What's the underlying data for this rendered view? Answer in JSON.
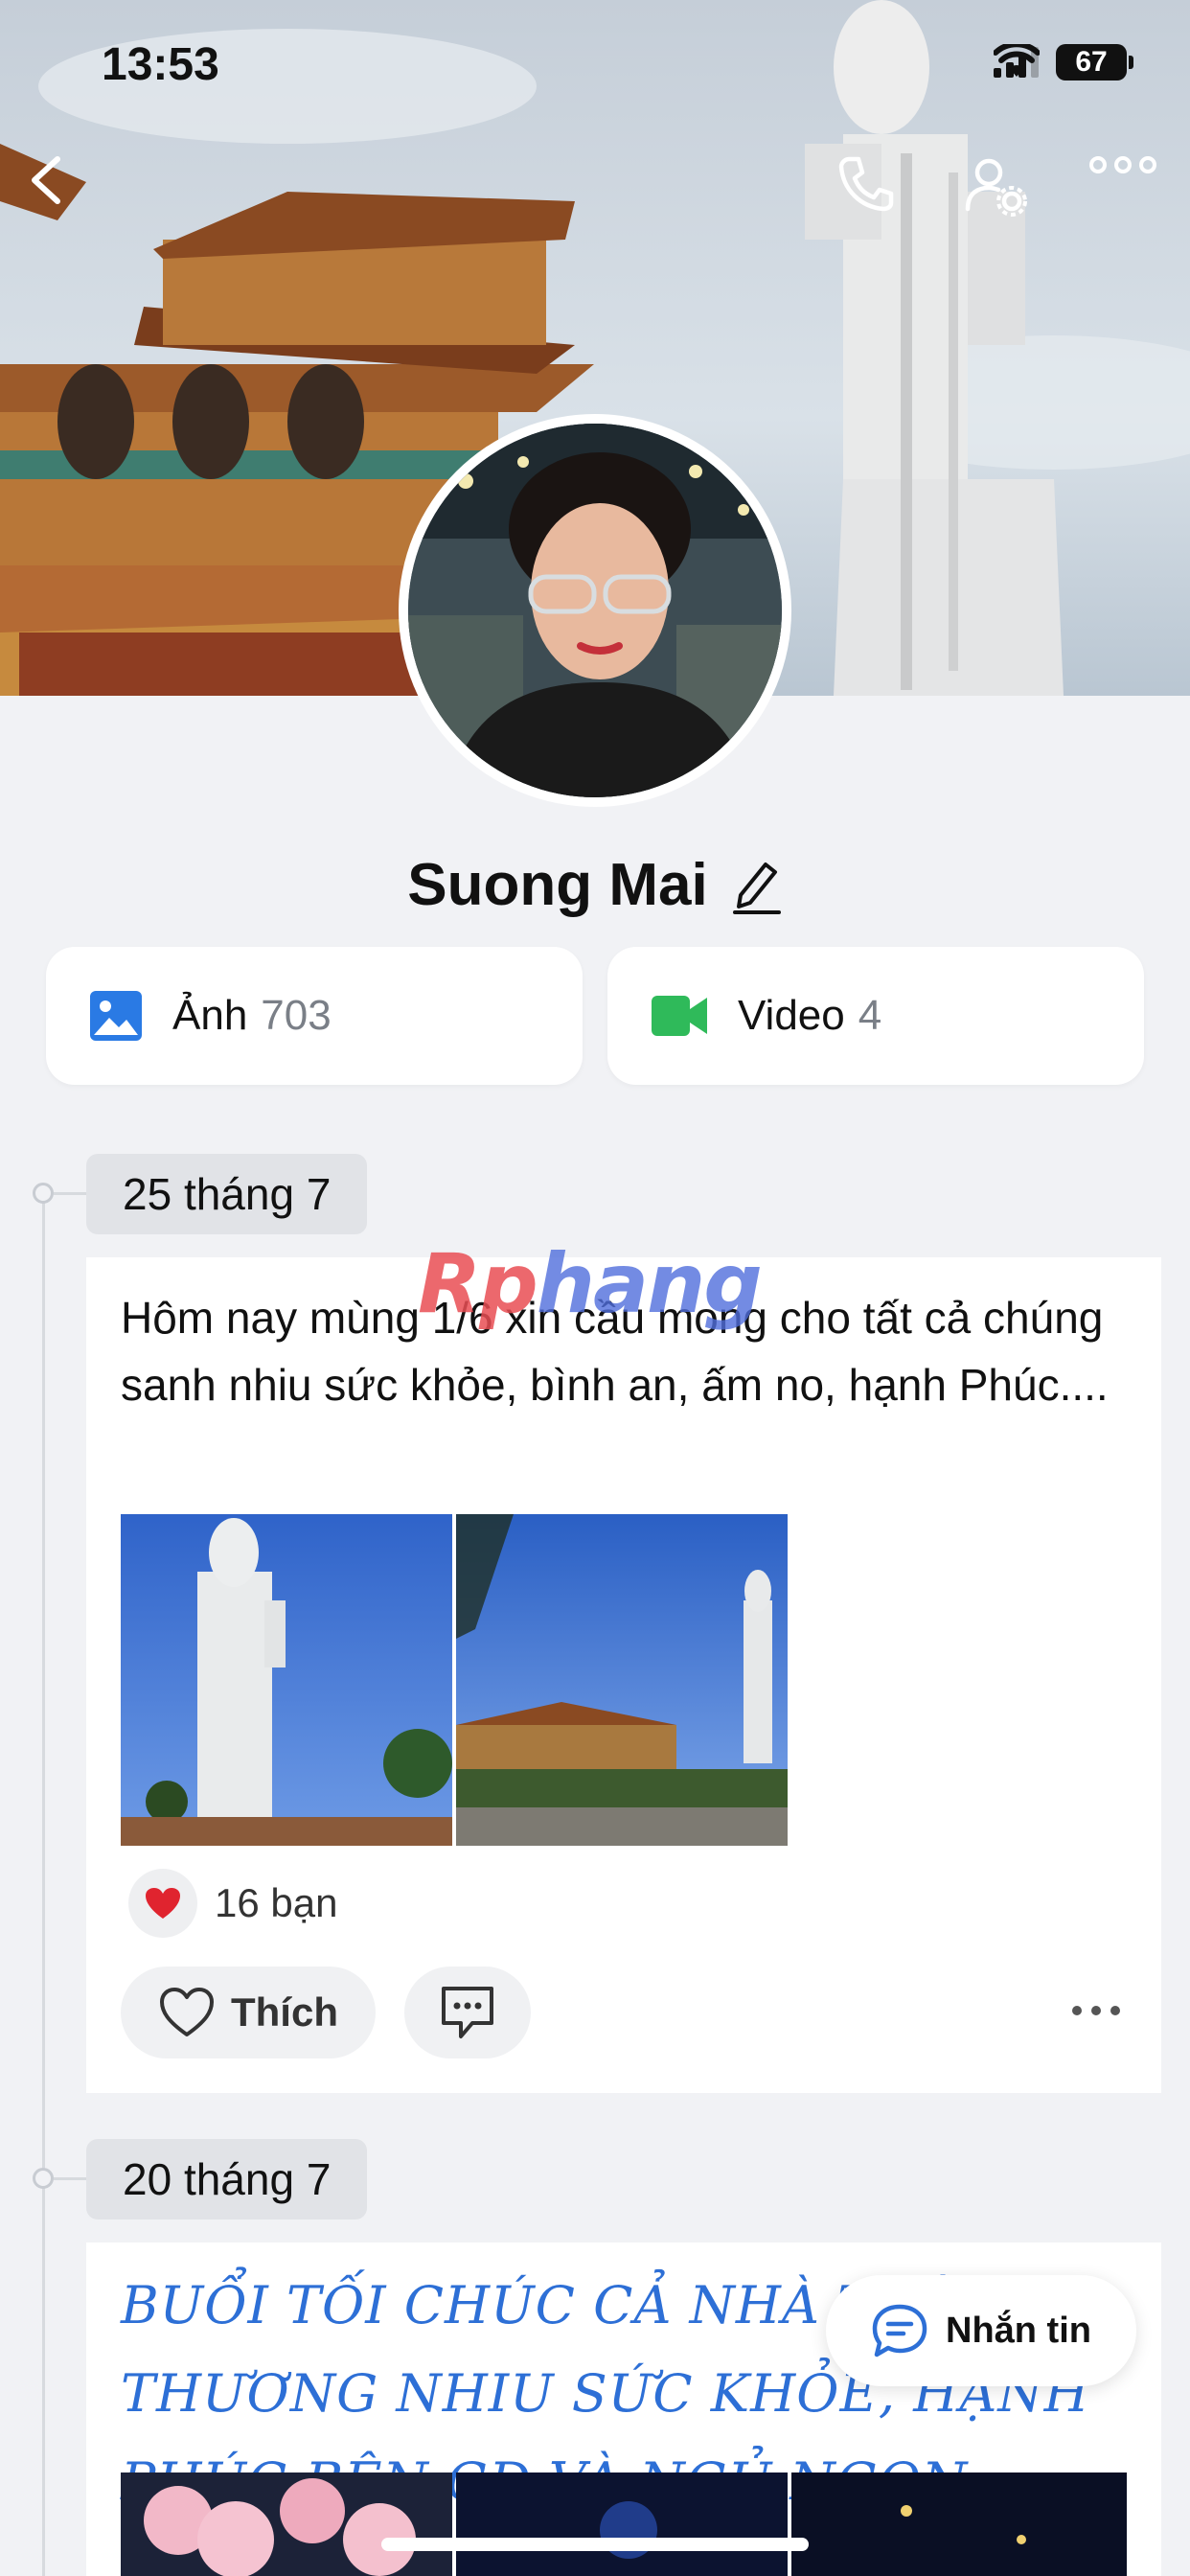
{
  "status_bar": {
    "time": "13:53",
    "battery": "67"
  },
  "profile": {
    "name": "Suong Mai"
  },
  "media": [
    {
      "label": "Ảnh",
      "count": "703"
    },
    {
      "label": "Video",
      "count": "4"
    }
  ],
  "watermark": {
    "a": "Rp",
    "b": "hang"
  },
  "posts": [
    {
      "date": "25 tháng 7",
      "text": "Hôm nay mùng 1/6 xin cầu mong cho tất cả chúng sanh nhiu sức khỏe, bình an, ấm no, hạnh Phúc....",
      "reactions": "16 bạn",
      "like_label": "Thích"
    },
    {
      "date": "20 tháng 7",
      "text": "Buổi tối chúc cả nhà thân thương nhiu sức khỏe, hạnh Phúc bên GĐ và ngủ ngon..."
    }
  ],
  "message_button": {
    "label": "Nhắn tin"
  },
  "colors": {
    "accent_blue": "#2d6fd6",
    "video_green": "#2fba5a",
    "heart_red": "#e0242f"
  }
}
